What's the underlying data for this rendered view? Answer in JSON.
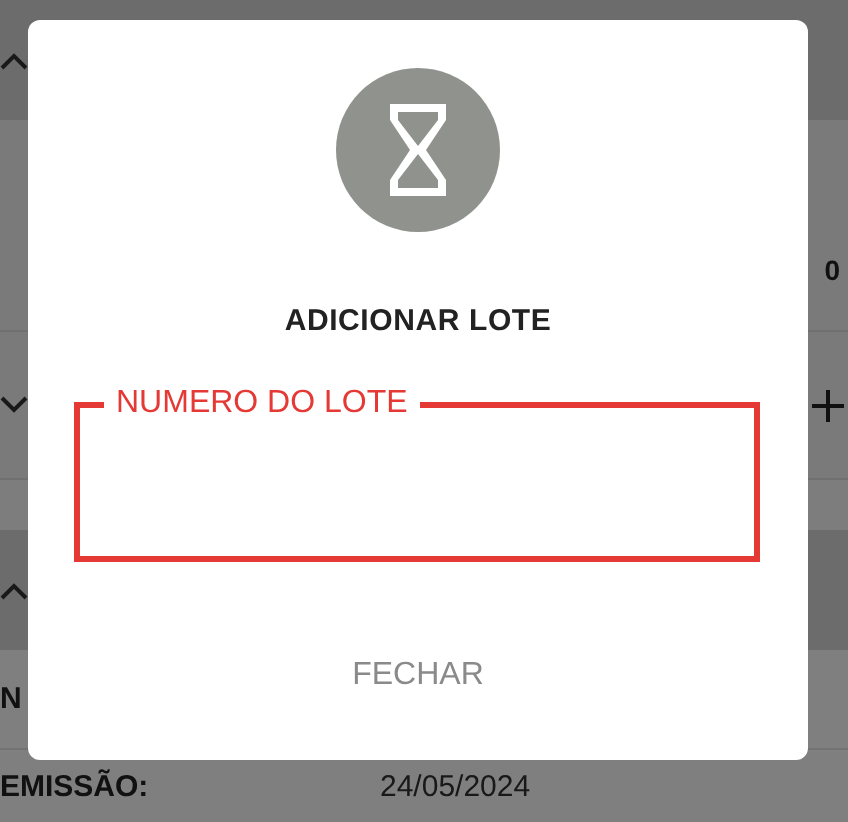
{
  "background": {
    "count": "0",
    "number_label": "N",
    "emission_label": "EMISSÃO:",
    "emission_date": "24/05/2024"
  },
  "dialog": {
    "title": "ADICIONAR LOTE",
    "field": {
      "label": "NUMERO DO LOTE",
      "focused": true
    },
    "close_button": "FECHAR"
  }
}
